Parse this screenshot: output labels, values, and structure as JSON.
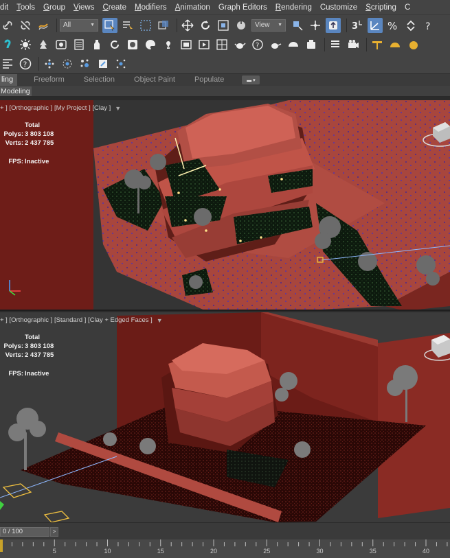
{
  "menu": {
    "items": [
      {
        "pre": "",
        "u": "",
        "post": "dit"
      },
      {
        "pre": "",
        "u": "T",
        "post": "ools"
      },
      {
        "pre": "",
        "u": "G",
        "post": "roup"
      },
      {
        "pre": "",
        "u": "V",
        "post": "iews"
      },
      {
        "pre": "",
        "u": "C",
        "post": "reate"
      },
      {
        "pre": "",
        "u": "M",
        "post": "odifiers"
      },
      {
        "pre": "",
        "u": "A",
        "post": "nimation"
      },
      {
        "pre": "",
        "u": "",
        "post": "Graph Editors"
      },
      {
        "pre": "",
        "u": "R",
        "post": "endering"
      },
      {
        "pre": "",
        "u": "",
        "post": "Customize"
      },
      {
        "pre": "",
        "u": "S",
        "post": "cripting"
      },
      {
        "pre": "",
        "u": "",
        "post": "C"
      }
    ]
  },
  "toolbar": {
    "selection_filter": "All",
    "coord_system": "View"
  },
  "ribbon": {
    "tabs": [
      "ling",
      "Freeform",
      "Selection",
      "Object Paint",
      "Populate"
    ],
    "active_panel": "Modeling"
  },
  "viewports": [
    {
      "label": "+ ] [Orthographic ] [My Project ] [Clay ]",
      "stats": {
        "header": "Total",
        "polys_label": "Polys:",
        "polys": "3 803 108",
        "verts_label": "Verts:",
        "verts": "2 437 785",
        "fps_label": "FPS:",
        "fps": "Inactive"
      }
    },
    {
      "label": "+ ] [Orthographic ] [Standard ] [Clay + Edged Faces ]",
      "stats": {
        "header": "Total",
        "polys_label": "Polys:",
        "polys": "3 803 108",
        "verts_label": "Verts:",
        "verts": "2 437 785",
        "fps_label": "FPS:",
        "fps": "Inactive"
      }
    }
  ],
  "timeline": {
    "frame_display": "0 / 100",
    "next_label": ">",
    "ticks": [
      5,
      10,
      15,
      20,
      25,
      30,
      35,
      40
    ]
  },
  "colors": {
    "clay": "#a5453c",
    "clay_dark": "#6e1d18",
    "foliage": "#0f1a10",
    "ui_bg": "#444444"
  }
}
